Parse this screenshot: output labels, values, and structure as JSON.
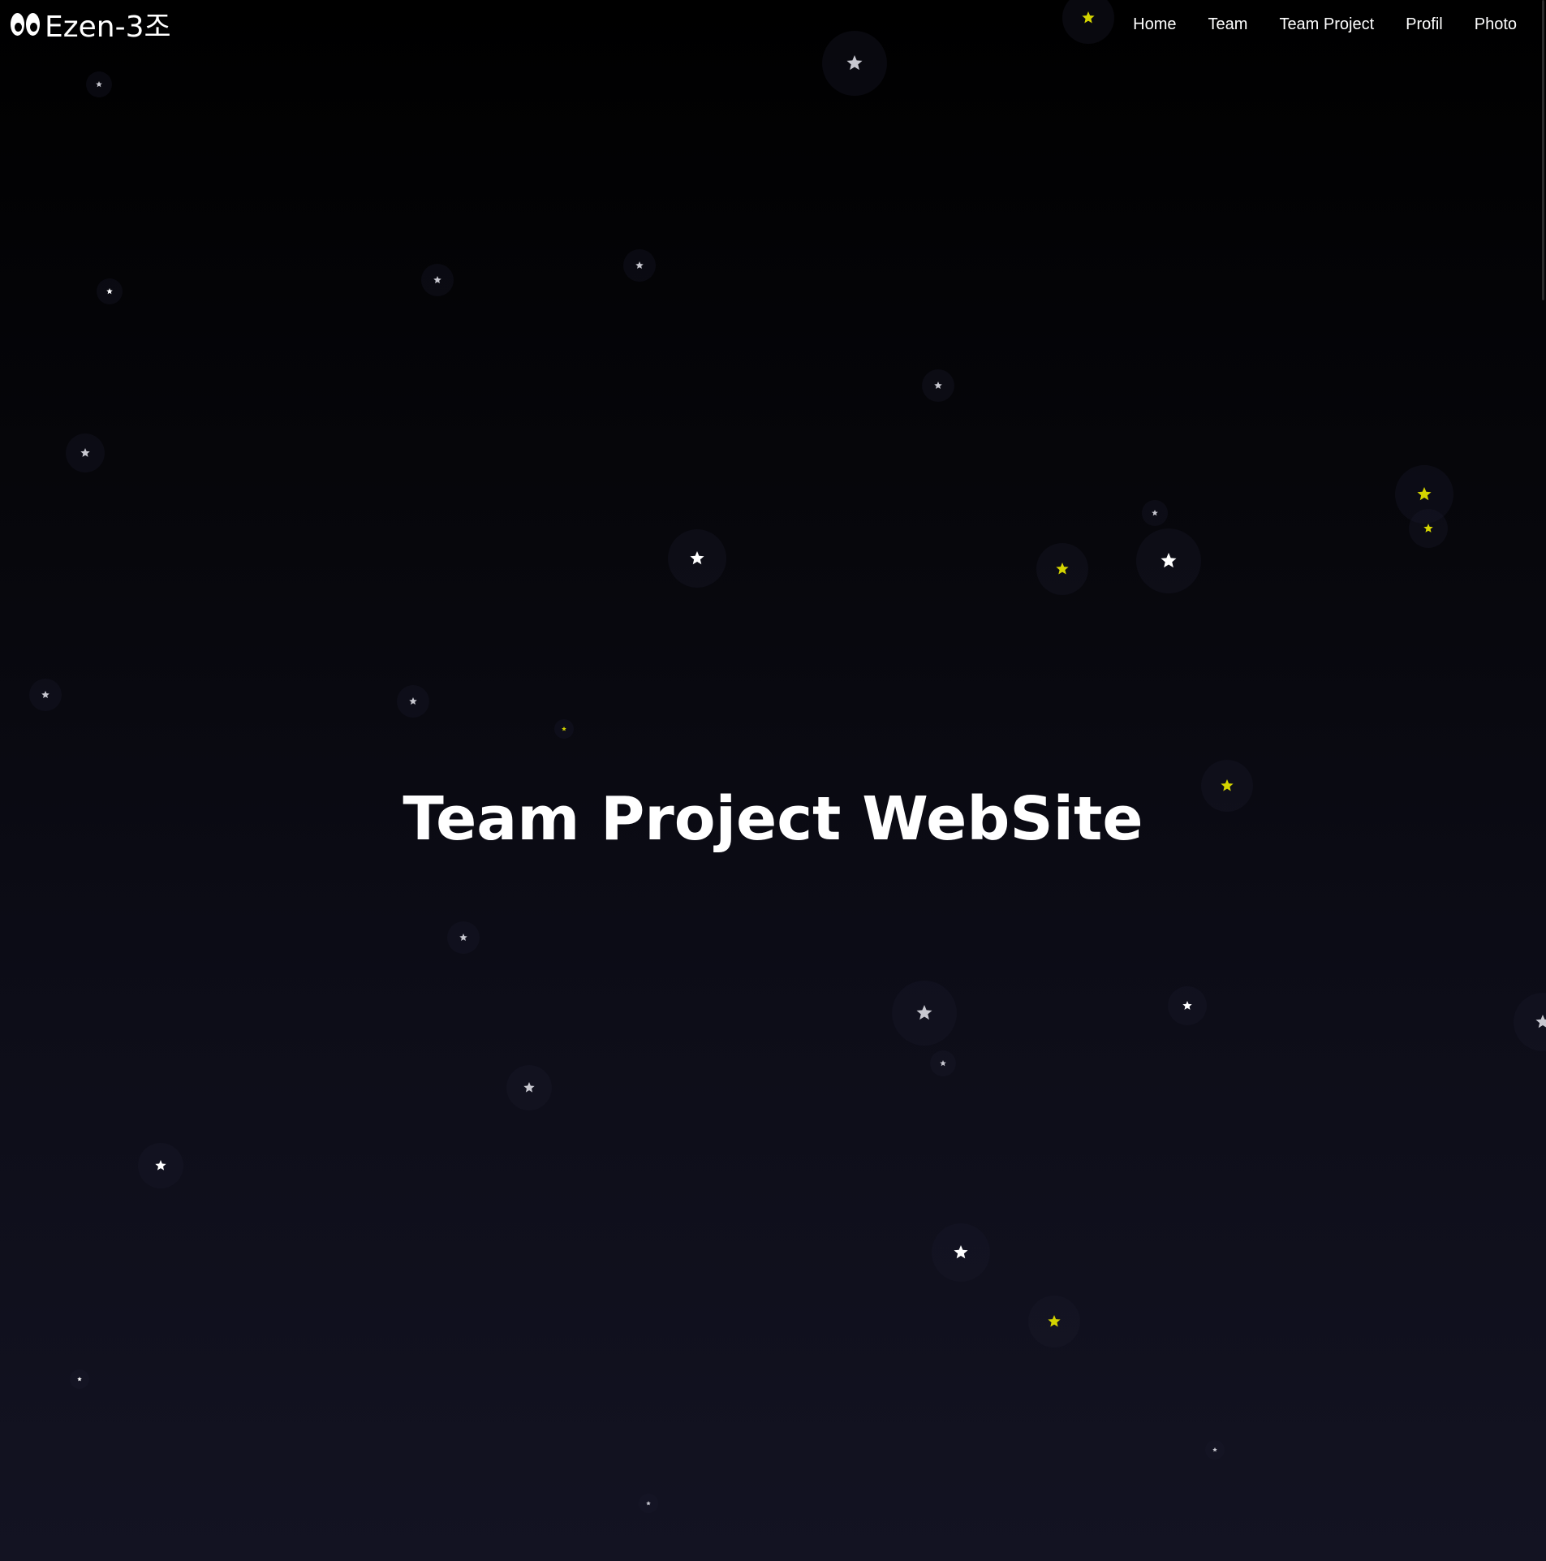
{
  "brand": {
    "logo_icon": "eyes-icon",
    "name": "Ezen-3조"
  },
  "nav": {
    "items": [
      {
        "label": "Home"
      },
      {
        "label": "Team"
      },
      {
        "label": "Team Project"
      },
      {
        "label": "Profil"
      },
      {
        "label": "Photo"
      }
    ]
  },
  "hero": {
    "title": "Team Project WebSite"
  },
  "colors": {
    "background_top": "#000000",
    "background_bottom": "#131322",
    "star_white": "#ffffff",
    "star_gray": "#c8c8d0",
    "star_yellow": "#d4d400"
  },
  "decoration": {
    "icon": "star-icon"
  }
}
